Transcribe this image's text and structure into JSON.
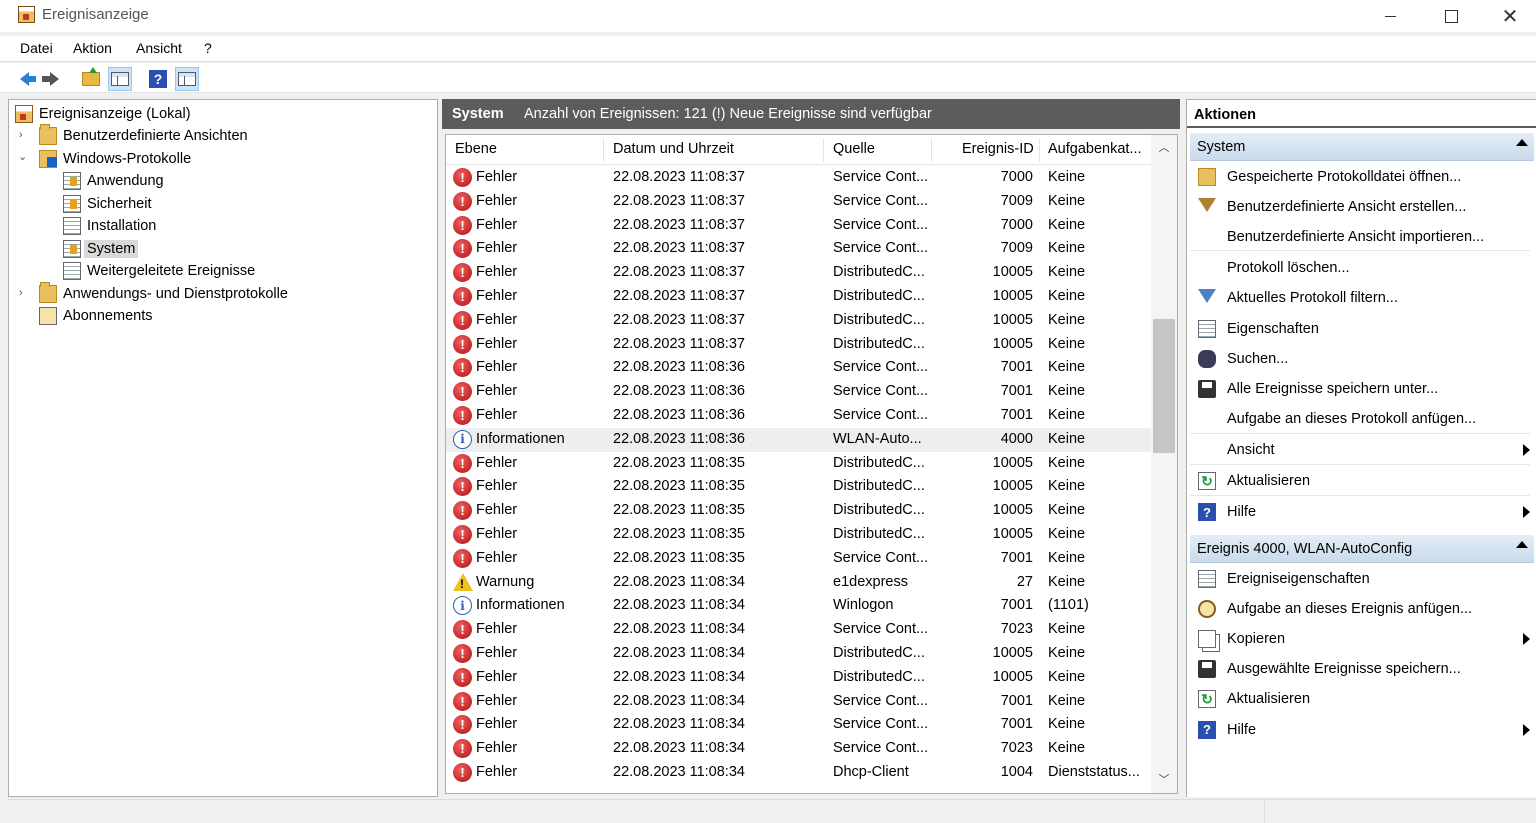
{
  "window": {
    "title": "Ereignisanzeige",
    "minimize": "",
    "maximize": "",
    "close": "✕"
  },
  "menu": [
    "Datei",
    "Aktion",
    "Ansicht",
    "?"
  ],
  "toolbar": {
    "back": "back-icon",
    "forward": "forward-icon",
    "up": "folder-up-icon",
    "show_hide": "console-tree-icon",
    "help": "?",
    "action_pane": "action-pane-icon"
  },
  "tree": {
    "root": "Ereignisanzeige (Lokal)",
    "custom_views": "Benutzerdefinierte Ansichten",
    "windows_logs": "Windows-Protokolle",
    "logs": [
      "Anwendung",
      "Sicherheit",
      "Installation",
      "System",
      "Weitergeleitete Ereignisse"
    ],
    "app_service_logs": "Anwendungs- und Dienstprotokolle",
    "subscriptions": "Abonnements",
    "expand_glyph": "›",
    "collapse_glyph": "⌄"
  },
  "center": {
    "title": "System",
    "info": "Anzahl von Ereignissen: 121 (!) Neue Ereignisse sind verfügbar",
    "columns": [
      "Ebene",
      "Datum und Uhrzeit",
      "Quelle",
      "Ereignis-ID",
      "Aufgabenkat..."
    ],
    "rows": [
      {
        "level": "Fehler",
        "type": "error",
        "date": "22.08.2023 11:08:37",
        "source": "Service Cont...",
        "id": "7000",
        "task": "Keine"
      },
      {
        "level": "Fehler",
        "type": "error",
        "date": "22.08.2023 11:08:37",
        "source": "Service Cont...",
        "id": "7009",
        "task": "Keine"
      },
      {
        "level": "Fehler",
        "type": "error",
        "date": "22.08.2023 11:08:37",
        "source": "Service Cont...",
        "id": "7000",
        "task": "Keine"
      },
      {
        "level": "Fehler",
        "type": "error",
        "date": "22.08.2023 11:08:37",
        "source": "Service Cont...",
        "id": "7009",
        "task": "Keine"
      },
      {
        "level": "Fehler",
        "type": "error",
        "date": "22.08.2023 11:08:37",
        "source": "DistributedC...",
        "id": "10005",
        "task": "Keine"
      },
      {
        "level": "Fehler",
        "type": "error",
        "date": "22.08.2023 11:08:37",
        "source": "DistributedC...",
        "id": "10005",
        "task": "Keine"
      },
      {
        "level": "Fehler",
        "type": "error",
        "date": "22.08.2023 11:08:37",
        "source": "DistributedC...",
        "id": "10005",
        "task": "Keine"
      },
      {
        "level": "Fehler",
        "type": "error",
        "date": "22.08.2023 11:08:37",
        "source": "DistributedC...",
        "id": "10005",
        "task": "Keine"
      },
      {
        "level": "Fehler",
        "type": "error",
        "date": "22.08.2023 11:08:36",
        "source": "Service Cont...",
        "id": "7001",
        "task": "Keine"
      },
      {
        "level": "Fehler",
        "type": "error",
        "date": "22.08.2023 11:08:36",
        "source": "Service Cont...",
        "id": "7001",
        "task": "Keine"
      },
      {
        "level": "Fehler",
        "type": "error",
        "date": "22.08.2023 11:08:36",
        "source": "Service Cont...",
        "id": "7001",
        "task": "Keine"
      },
      {
        "level": "Informationen",
        "type": "info",
        "date": "22.08.2023 11:08:36",
        "source": "WLAN-Auto...",
        "id": "4000",
        "task": "Keine",
        "highlight": true
      },
      {
        "level": "Fehler",
        "type": "error",
        "date": "22.08.2023 11:08:35",
        "source": "DistributedC...",
        "id": "10005",
        "task": "Keine"
      },
      {
        "level": "Fehler",
        "type": "error",
        "date": "22.08.2023 11:08:35",
        "source": "DistributedC...",
        "id": "10005",
        "task": "Keine"
      },
      {
        "level": "Fehler",
        "type": "error",
        "date": "22.08.2023 11:08:35",
        "source": "DistributedC...",
        "id": "10005",
        "task": "Keine"
      },
      {
        "level": "Fehler",
        "type": "error",
        "date": "22.08.2023 11:08:35",
        "source": "DistributedC...",
        "id": "10005",
        "task": "Keine"
      },
      {
        "level": "Fehler",
        "type": "error",
        "date": "22.08.2023 11:08:35",
        "source": "Service Cont...",
        "id": "7001",
        "task": "Keine"
      },
      {
        "level": "Warnung",
        "type": "warning",
        "date": "22.08.2023 11:08:34",
        "source": "e1dexpress",
        "id": "27",
        "task": "Keine"
      },
      {
        "level": "Informationen",
        "type": "info",
        "date": "22.08.2023 11:08:34",
        "source": "Winlogon",
        "id": "7001",
        "task": "(1101)"
      },
      {
        "level": "Fehler",
        "type": "error",
        "date": "22.08.2023 11:08:34",
        "source": "Service Cont...",
        "id": "7023",
        "task": "Keine"
      },
      {
        "level": "Fehler",
        "type": "error",
        "date": "22.08.2023 11:08:34",
        "source": "DistributedC...",
        "id": "10005",
        "task": "Keine"
      },
      {
        "level": "Fehler",
        "type": "error",
        "date": "22.08.2023 11:08:34",
        "source": "DistributedC...",
        "id": "10005",
        "task": "Keine"
      },
      {
        "level": "Fehler",
        "type": "error",
        "date": "22.08.2023 11:08:34",
        "source": "Service Cont...",
        "id": "7001",
        "task": "Keine"
      },
      {
        "level": "Fehler",
        "type": "error",
        "date": "22.08.2023 11:08:34",
        "source": "Service Cont...",
        "id": "7001",
        "task": "Keine"
      },
      {
        "level": "Fehler",
        "type": "error",
        "date": "22.08.2023 11:08:34",
        "source": "Service Cont...",
        "id": "7023",
        "task": "Keine"
      },
      {
        "level": "Fehler",
        "type": "error",
        "date": "22.08.2023 11:08:34",
        "source": "Dhcp-Client",
        "id": "1004",
        "task": "Dienststatus..."
      }
    ]
  },
  "actions": {
    "title": "Aktionen",
    "section1": {
      "title": "System",
      "items": [
        {
          "label": "Gespeicherte Protokolldatei öffnen...",
          "icon": "open-log-icon",
          "submenu": false
        },
        {
          "label": "Benutzerdefinierte Ansicht erstellen...",
          "icon": "create-view-icon",
          "submenu": false
        },
        {
          "label": "Benutzerdefinierte Ansicht importieren...",
          "icon": "",
          "submenu": false
        },
        {
          "label": "Protokoll löschen...",
          "icon": "",
          "submenu": false
        },
        {
          "label": "Aktuelles Protokoll filtern...",
          "icon": "filter-icon",
          "submenu": false
        },
        {
          "label": "Eigenschaften",
          "icon": "properties-icon",
          "submenu": false
        },
        {
          "label": "Suchen...",
          "icon": "find-icon",
          "submenu": false
        },
        {
          "label": "Alle Ereignisse speichern unter...",
          "icon": "save-icon",
          "submenu": false
        },
        {
          "label": "Aufgabe an dieses Protokoll anfügen...",
          "icon": "",
          "submenu": false
        },
        {
          "label": "Ansicht",
          "icon": "",
          "submenu": true
        },
        {
          "label": "Aktualisieren",
          "icon": "refresh-icon",
          "submenu": false
        },
        {
          "label": "Hilfe",
          "icon": "help-icon",
          "submenu": true
        }
      ]
    },
    "section2": {
      "title": "Ereignis 4000, WLAN-AutoConfig",
      "items": [
        {
          "label": "Ereigniseigenschaften",
          "icon": "properties-icon",
          "submenu": false
        },
        {
          "label": "Aufgabe an dieses Ereignis anfügen...",
          "icon": "task-icon",
          "submenu": false
        },
        {
          "label": "Kopieren",
          "icon": "copy-icon",
          "submenu": true
        },
        {
          "label": "Ausgewählte Ereignisse speichern...",
          "icon": "save-icon",
          "submenu": false
        },
        {
          "label": "Aktualisieren",
          "icon": "refresh-icon",
          "submenu": false
        },
        {
          "label": "Hilfe",
          "icon": "help-icon",
          "submenu": true
        }
      ]
    }
  },
  "colors": {
    "error": "#c01818",
    "info": "#2a5fb0",
    "warning": "#f0c020",
    "header_bg": "#5c5c5c",
    "section_bg": "#c9daea"
  }
}
